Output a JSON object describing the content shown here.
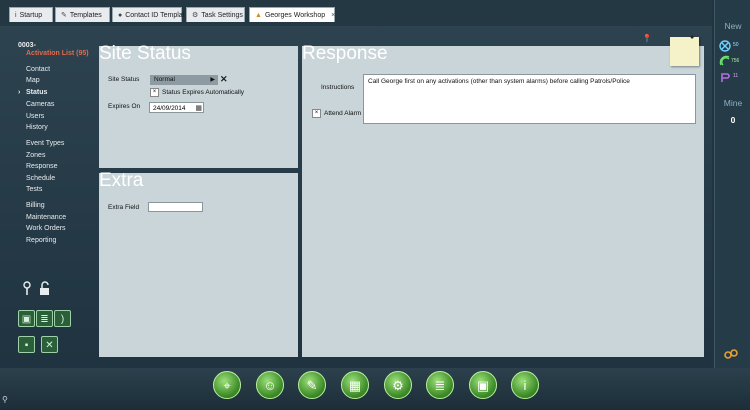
{
  "tabs": [
    {
      "label": "Startup",
      "icon": "info-icon"
    },
    {
      "label": "Templates",
      "icon": "wrench-icon"
    },
    {
      "label": "Contact ID Templat",
      "icon": "person-icon"
    },
    {
      "label": "Task Settings",
      "icon": "gear-icon"
    },
    {
      "label": "Georges Workshop",
      "icon": "alert-icon",
      "close": "×"
    }
  ],
  "sidebar": {
    "site_id": "0003-",
    "activation": "Activation List (95)",
    "items": [
      "Contact",
      "Map",
      "Status",
      "Cameras",
      "Users",
      "History",
      "Event Types",
      "Zones",
      "Response",
      "Schedule",
      "Tests",
      "Billing",
      "Maintenance",
      "Work Orders",
      "Reporting"
    ],
    "current": "Status",
    "arrow": "›"
  },
  "site_status": {
    "heading": "Site Status",
    "status_label": "Site Status",
    "status_value": "Normal",
    "expires_auto_label": "Status Expires Automatically",
    "expires_on_label": "Expires On",
    "expires_on_value": "24/09/2014"
  },
  "extra": {
    "heading": "Extra",
    "field_label": "Extra Field",
    "field_value": ""
  },
  "response": {
    "heading": "Response",
    "instructions_label": "Instructions",
    "instructions_value": "Call George first on any activations (other than system alarms) before calling Patrols/Police",
    "attend_label": "Attend Alarm"
  },
  "right_panel": {
    "new_label": "New",
    "count_1": "50",
    "count_2": "756",
    "count_3": "11",
    "mine_label": "Mine",
    "mine_value": "0"
  },
  "checkmark": "×",
  "colors": {
    "accent": "#e06a4c",
    "panel": "#c9d5d9",
    "button_green": "#4c9a30"
  }
}
